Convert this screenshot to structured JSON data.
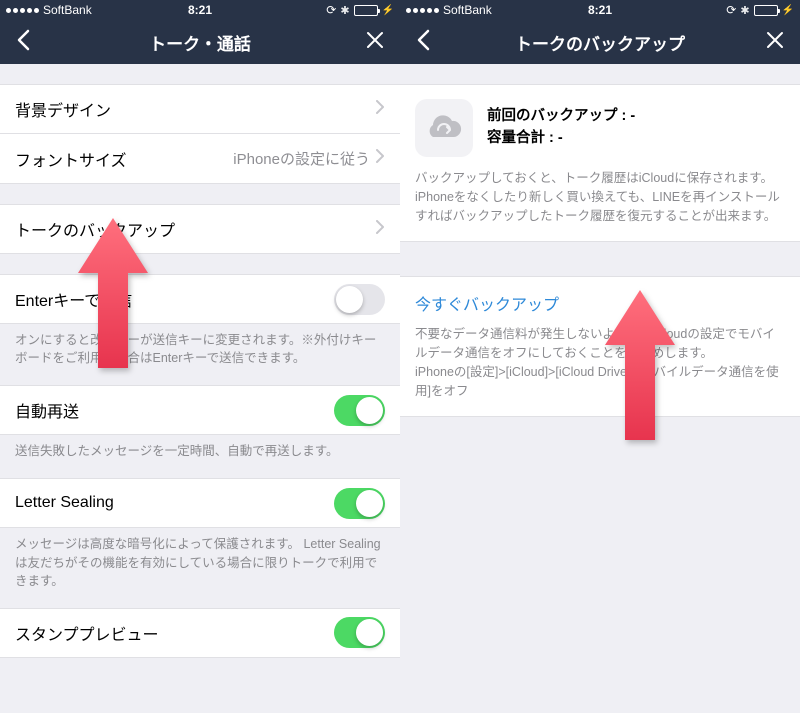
{
  "status": {
    "carrier": "SoftBank",
    "time": "8:21"
  },
  "left": {
    "title": "トーク・通話",
    "rows": {
      "background_design": "背景デザイン",
      "font_size_label": "フォントサイズ",
      "font_size_value": "iPhoneの設定に従う",
      "backup": "トークのバックアップ",
      "enter_send": "Enterキーで送信",
      "enter_note": "オンにすると改行キーが送信キーに変更されます。※外付けキーボードをご利用の場合はEnterキーで送信できます。",
      "auto_resend": "自動再送",
      "auto_resend_note": "送信失敗したメッセージを一定時間、自動で再送します。",
      "letter_sealing": "Letter Sealing",
      "letter_sealing_note": "メッセージは高度な暗号化によって保護されます。 Letter Sealingは友だちがその機能を有効にしている場合に限りトークで利用できます。",
      "stamp_preview": "スタンププレビュー"
    }
  },
  "right": {
    "title": "トークのバックアップ",
    "last_backup_label": "前回のバックアップ : -",
    "size_label": "容量合計 : -",
    "desc": "バックアップしておくと、トーク履歴はiCloudに保存されます。iPhoneをなくしたり新しく買い換えても、LINEを再インストールすればバックアップしたトーク履歴を復元することが出来ます。",
    "backup_now": "今すぐバックアップ",
    "backup_note": "不要なデータ通信料が発生しないように、iCloudの設定でモバイルデータ通信をオフにしておくことをお薦めします。\niPhoneの[設定]>[iCloud]>[iCloud Drive]>[モバイルデータ通信を使用]をオフ"
  }
}
